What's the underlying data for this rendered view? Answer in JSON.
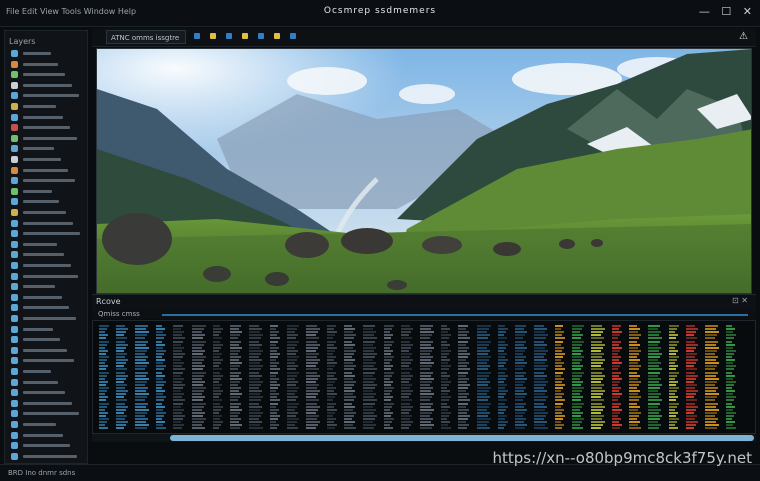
{
  "window": {
    "title": "Ocsmrep  ssdmemers",
    "menu": "File  Edit  View  Tools  Window  Help",
    "controls": [
      "—",
      "☐",
      "✕"
    ]
  },
  "sidebar": {
    "header": "Layers",
    "items": [
      {
        "label": "",
        "icon_color": "#5aa7d8"
      },
      {
        "label": "",
        "icon_color": "#d88a3a"
      },
      {
        "label": "",
        "icon_color": "#6cc26a"
      },
      {
        "label": "",
        "icon_color": "#c9cfd4"
      },
      {
        "label": "",
        "icon_color": "#5aa7d8"
      },
      {
        "label": "",
        "icon_color": "#d0b040"
      },
      {
        "label": "",
        "icon_color": "#5aa7d8"
      },
      {
        "label": "",
        "icon_color": "#c45050"
      },
      {
        "label": "",
        "icon_color": "#6cc26a"
      },
      {
        "label": "",
        "icon_color": "#5aa7d8"
      },
      {
        "label": "",
        "icon_color": "#c9cfd4"
      },
      {
        "label": "",
        "icon_color": "#d88a3a"
      },
      {
        "label": "",
        "icon_color": "#5aa7d8"
      },
      {
        "label": "",
        "icon_color": "#6cc26a"
      },
      {
        "label": "",
        "icon_color": "#5aa7d8"
      },
      {
        "label": "",
        "icon_color": "#d0b040"
      },
      {
        "label": "",
        "icon_color": "#5aa7d8"
      },
      {
        "label": "",
        "icon_color": "#5aa7d8"
      },
      {
        "label": "",
        "icon_color": "#5aa7d8"
      },
      {
        "label": "",
        "icon_color": "#5aa7d8"
      },
      {
        "label": "",
        "icon_color": "#5aa7d8"
      },
      {
        "label": "",
        "icon_color": "#5aa7d8"
      },
      {
        "label": "",
        "icon_color": "#5aa7d8"
      },
      {
        "label": "",
        "icon_color": "#5aa7d8"
      },
      {
        "label": "",
        "icon_color": "#5aa7d8"
      },
      {
        "label": "",
        "icon_color": "#5aa7d8"
      },
      {
        "label": "",
        "icon_color": "#5aa7d8"
      },
      {
        "label": "",
        "icon_color": "#5aa7d8"
      },
      {
        "label": "",
        "icon_color": "#5aa7d8"
      },
      {
        "label": "",
        "icon_color": "#5aa7d8"
      },
      {
        "label": "",
        "icon_color": "#5aa7d8"
      },
      {
        "label": "",
        "icon_color": "#5aa7d8"
      },
      {
        "label": "",
        "icon_color": "#5aa7d8"
      },
      {
        "label": "",
        "icon_color": "#5aa7d8"
      },
      {
        "label": "",
        "icon_color": "#5aa7d8"
      },
      {
        "label": "",
        "icon_color": "#5aa7d8"
      },
      {
        "label": "",
        "icon_color": "#5aa7d8"
      },
      {
        "label": "",
        "icon_color": "#5aa7d8"
      },
      {
        "label": "",
        "icon_color": "#5aa7d8"
      }
    ]
  },
  "toolbar": {
    "tab_label": "ATNC omms issgtre",
    "buttons": [
      "#2f7fd0",
      "#e0c040",
      "#2f7fd0",
      "#e0c040",
      "#2f7fd0",
      "#e0c040",
      "#2f7fd0"
    ],
    "alert_icon": "warning-icon"
  },
  "viewer": {
    "image": "mountain-valley-landscape"
  },
  "panel": {
    "title": "Rcove",
    "subtab": "Qmiss  cmss",
    "controls": "⊡  ✕"
  },
  "statusbar": {
    "left": "BRD  Ino   dnmr  sdns",
    "watermark": "https://xn--o80bp9mc8ck3f75y.net"
  },
  "colors": {
    "accent": "#2a6fa0",
    "scroll": "#7fb3d6",
    "data_cols": [
      "#3b8fc4",
      "#2a5f86",
      "#6a7580",
      "#454f58",
      "#e0a020",
      "#3aa84a",
      "#c8d040",
      "#e04030"
    ]
  }
}
